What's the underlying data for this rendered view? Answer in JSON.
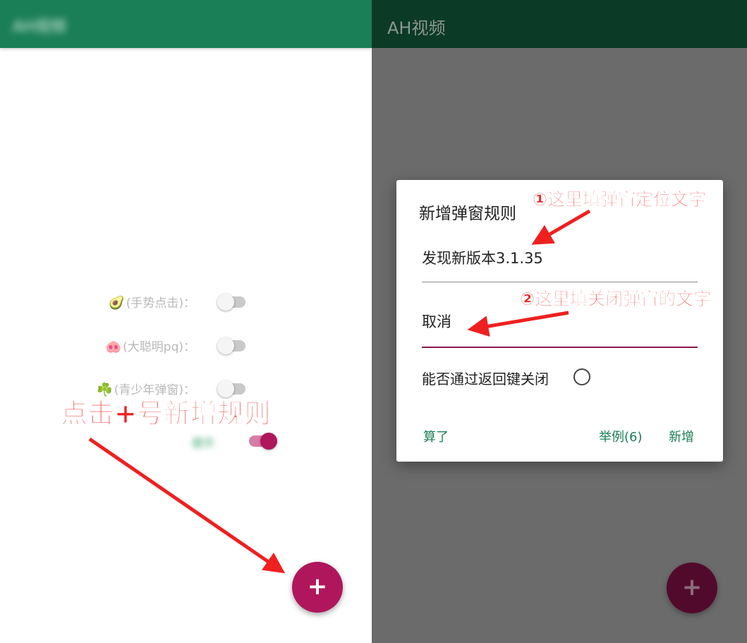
{
  "left_screen": {
    "app_title": "AH视频",
    "toggles": [
      {
        "emoji": "🥑",
        "label": "(手势点击)：",
        "on": false
      },
      {
        "emoji": "🐽",
        "label": "(大聪明pq)：",
        "on": false
      },
      {
        "emoji": "☘️",
        "label": "(青少年弹窗)：",
        "on": false
      }
    ],
    "blurred_label": "提示",
    "blurred_toggle_on": true,
    "fab_label": "+"
  },
  "right_screen": {
    "app_title": "AH视频",
    "fab_label": "+",
    "dialog": {
      "title": "新增弹窗规则",
      "locate_text_value": "发现新版本3.1.35",
      "close_text_value": "取消",
      "back_close_label": "能否通过返回键关闭",
      "back_close_checked": false,
      "cancel_label": "算了",
      "example_label": "举例(6)",
      "add_label": "新增"
    }
  },
  "annotations": {
    "left": "点击+号新增规则",
    "right_1": "①这里填弹窗定位文字",
    "right_2": "②这里填关闭弹窗的文字",
    "color": "#ef2020"
  },
  "colors": {
    "appbar_left": "#1a7f56",
    "appbar_right": "#0b3a27",
    "accent": "#b0165c",
    "button_text": "#1a7f56"
  }
}
